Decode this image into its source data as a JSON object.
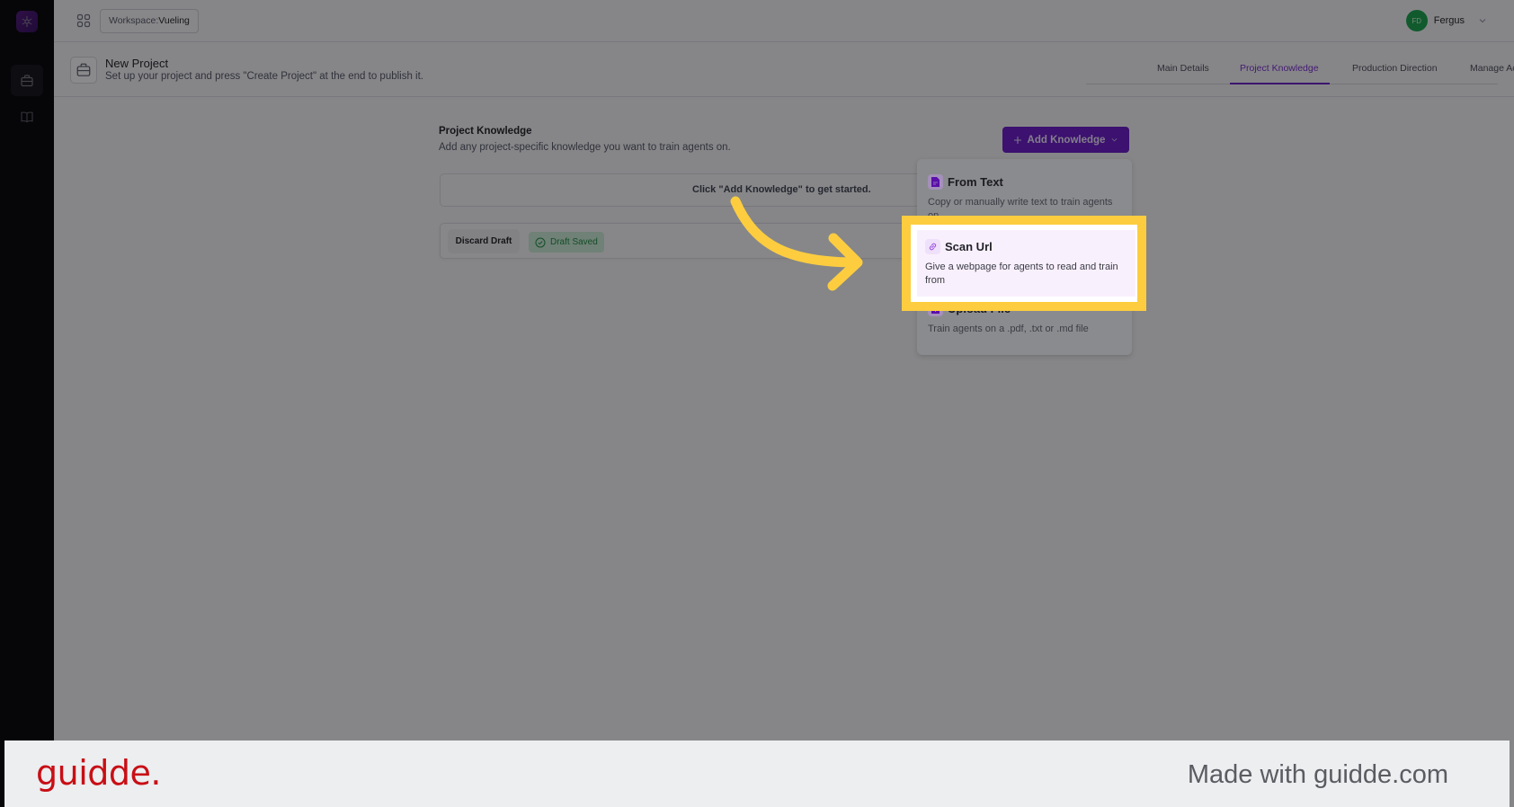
{
  "topbar": {
    "workspace_label": "Workspace:",
    "workspace_name": "Vueling",
    "user": {
      "initials": "FD",
      "name": "Fergus"
    }
  },
  "sidebar": {
    "items": [
      {
        "icon": "briefcase-icon",
        "active": true
      },
      {
        "icon": "book-icon",
        "active": false
      }
    ]
  },
  "header": {
    "title": "New Project",
    "subtitle": "Set up your project and press \"Create Project\" at the end to publish it.",
    "tabs": [
      {
        "label": "Main Details",
        "active": false
      },
      {
        "label": "Project Knowledge",
        "active": true
      },
      {
        "label": "Production Direction",
        "active": false
      },
      {
        "label": "Manage Access",
        "active": false
      }
    ]
  },
  "main": {
    "section_title": "Project Knowledge",
    "section_subtitle": "Add any project-specific knowledge you want to train agents on.",
    "add_button_label": "Add Knowledge",
    "empty_state": "Click \"Add Knowledge\" to get started.",
    "discard_label": "Discard Draft",
    "draft_status": "Draft Saved"
  },
  "dropdown": {
    "items": [
      {
        "title": "From Text",
        "description": "Copy or manually write text to train agents on",
        "icon": "document-icon"
      },
      {
        "title": "Scan Url",
        "description": "Give a webpage for agents to read and train from",
        "icon": "link-icon",
        "highlighted": true
      },
      {
        "title": "Upload File",
        "description": "Train agents on a .pdf, .txt or .md file",
        "icon": "file-upload-icon"
      }
    ]
  },
  "colors": {
    "accent": "#6a17c7",
    "highlight": "#fdcd3f",
    "success": "#1d8a3e",
    "brand_red": "#c80f15"
  },
  "footer": {
    "logo": "guidde.",
    "tagline": "Made with guidde.com"
  }
}
